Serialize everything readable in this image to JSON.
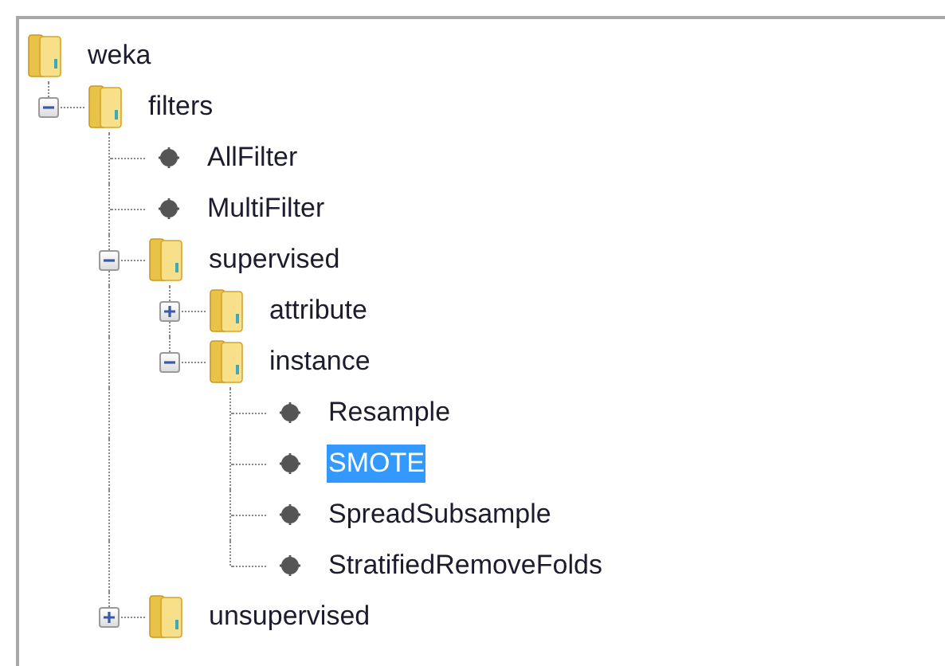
{
  "tree": [
    {
      "label": "weka",
      "kind": "folder",
      "selected": false,
      "children": [
        {
          "label": "filters",
          "kind": "folder",
          "expanded": true,
          "selected": false,
          "children": [
            {
              "label": "AllFilter",
              "kind": "leaf",
              "selected": false
            },
            {
              "label": "MultiFilter",
              "kind": "leaf",
              "selected": false
            },
            {
              "label": "supervised",
              "kind": "folder",
              "expanded": true,
              "selected": false,
              "children": [
                {
                  "label": "attribute",
                  "kind": "folder",
                  "expanded": false,
                  "selected": false
                },
                {
                  "label": "instance",
                  "kind": "folder",
                  "expanded": true,
                  "selected": false,
                  "children": [
                    {
                      "label": "Resample",
                      "kind": "leaf",
                      "selected": false
                    },
                    {
                      "label": "SMOTE",
                      "kind": "leaf",
                      "selected": true
                    },
                    {
                      "label": "SpreadSubsample",
                      "kind": "leaf",
                      "selected": false
                    },
                    {
                      "label": "StratifiedRemoveFolds",
                      "kind": "leaf",
                      "selected": false
                    }
                  ]
                }
              ]
            },
            {
              "label": "unsupervised",
              "kind": "folder",
              "expanded": false,
              "selected": false
            }
          ]
        }
      ]
    }
  ]
}
